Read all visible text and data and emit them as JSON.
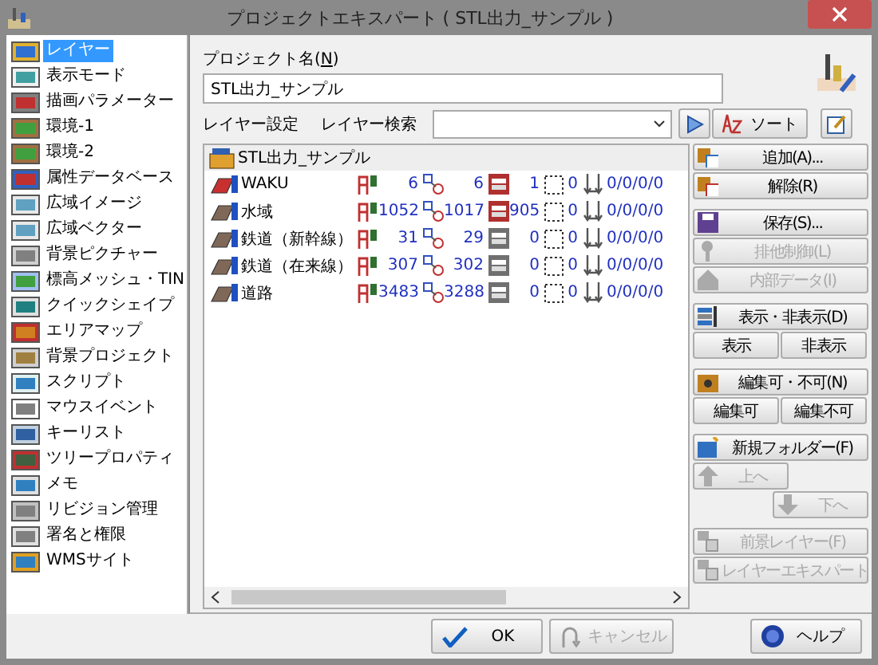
{
  "window": {
    "title": "プロジェクトエキスパート ( STL出力_サンプル )"
  },
  "sidebar": {
    "items": [
      {
        "label": "レイヤー",
        "selected": true
      },
      {
        "label": "表示モード",
        "selected": false
      },
      {
        "label": "描画パラメーター",
        "selected": false
      },
      {
        "label": "環境-1",
        "selected": false
      },
      {
        "label": "環境-2",
        "selected": false
      },
      {
        "label": "属性データベース",
        "selected": false
      },
      {
        "label": "広域イメージ",
        "selected": false
      },
      {
        "label": "広域ベクター",
        "selected": false
      },
      {
        "label": "背景ピクチャー",
        "selected": false
      },
      {
        "label": "標高メッシュ・TIN",
        "selected": false
      },
      {
        "label": "クイックシェイプ",
        "selected": false
      },
      {
        "label": "エリアマップ",
        "selected": false
      },
      {
        "label": "背景プロジェクト",
        "selected": false
      },
      {
        "label": "スクリプト",
        "selected": false
      },
      {
        "label": "マウスイベント",
        "selected": false
      },
      {
        "label": "キーリスト",
        "selected": false
      },
      {
        "label": "ツリープロパティ",
        "selected": false
      },
      {
        "label": "メモ",
        "selected": false
      },
      {
        "label": "リビジョン管理",
        "selected": false
      },
      {
        "label": "署名と権限",
        "selected": false
      },
      {
        "label": "WMSサイト",
        "selected": false
      }
    ]
  },
  "project_name": {
    "label": "プロジェクト名(N)",
    "value": "STL出力_サンプル"
  },
  "layer_settings": {
    "label": "レイヤー設定",
    "search_label": "レイヤー検索",
    "sort_button": "ソート"
  },
  "tree": {
    "root": "STL出力_サンプル",
    "rows": [
      {
        "name": "WAKU",
        "color": "#c83030",
        "count_1": "6",
        "count_2": "6",
        "area_filled": true,
        "count_3": "1",
        "count_4": "0",
        "count_5": "0/0/0/0"
      },
      {
        "name": "水域",
        "color": "#806858",
        "count_1": "1052",
        "count_2": "1017",
        "area_filled": true,
        "count_3": "905",
        "count_4": "0",
        "count_5": "0/0/0/0"
      },
      {
        "name": "鉄道（新幹線）",
        "color": "#806858",
        "count_1": "31",
        "count_2": "29",
        "area_filled": false,
        "count_3": "0",
        "count_4": "0",
        "count_5": "0/0/0/0"
      },
      {
        "name": "鉄道（在来線）",
        "color": "#806858",
        "count_1": "307",
        "count_2": "302",
        "area_filled": false,
        "count_3": "0",
        "count_4": "0",
        "count_5": "0/0/0/0"
      },
      {
        "name": "道路",
        "color": "#806858",
        "count_1": "3483",
        "count_2": "3288",
        "area_filled": false,
        "count_3": "0",
        "count_4": "0",
        "count_5": "0/0/0/0"
      }
    ]
  },
  "side_buttons": [
    [
      {
        "label": "追加(A)...",
        "kind": "full",
        "disabled": false
      },
      {
        "label": "解除(R)",
        "kind": "full",
        "disabled": false
      }
    ],
    [
      {
        "label": "保存(S)...",
        "kind": "full",
        "disabled": false
      },
      {
        "label": "排他制御(L)",
        "kind": "full",
        "disabled": true
      },
      {
        "label": "内部データ(I)",
        "kind": "full",
        "disabled": true
      }
    ],
    [
      {
        "label": "表示・非表示(D)",
        "kind": "full",
        "disabled": false
      },
      {
        "label": "表示",
        "kind": "half",
        "disabled": false
      },
      {
        "label": "非表示",
        "kind": "half",
        "disabled": false
      }
    ],
    [
      {
        "label": "編集可・不可(N)",
        "kind": "full",
        "disabled": false
      },
      {
        "label": "編集可",
        "kind": "half",
        "disabled": false
      },
      {
        "label": "編集不可",
        "kind": "half",
        "disabled": false
      }
    ],
    [
      {
        "label": "新規フォルダー(F)",
        "kind": "full",
        "disabled": false
      },
      {
        "label": "上へ",
        "kind": "left",
        "disabled": true
      },
      {
        "label": "下へ",
        "kind": "right",
        "disabled": true
      }
    ],
    [
      {
        "label": "前景レイヤー(F)",
        "kind": "full",
        "disabled": true
      },
      {
        "label": "レイヤーエキスパート",
        "kind": "full",
        "disabled": true
      }
    ]
  ],
  "footer": [
    {
      "label": "OK",
      "kind": "ok",
      "disabled": false
    },
    {
      "label": "キャンセル",
      "kind": "cancel",
      "disabled": true
    },
    {
      "label": "ヘルプ",
      "kind": "help",
      "disabled": false
    }
  ]
}
